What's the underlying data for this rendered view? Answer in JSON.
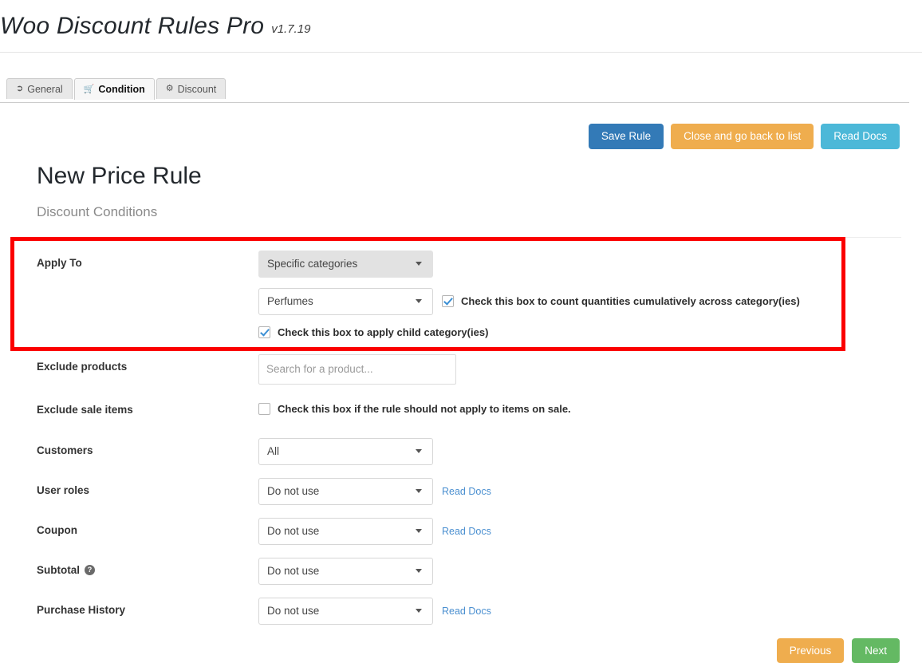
{
  "header": {
    "title": "Woo Discount Rules Pro",
    "version": "v1.7.19"
  },
  "tabs": [
    {
      "label": "General",
      "icon": "tag-icon",
      "glyph": "⚑",
      "active": false
    },
    {
      "label": "Condition",
      "icon": "cart-icon",
      "glyph": "🛒",
      "active": true
    },
    {
      "label": "Discount",
      "icon": "gears-icon",
      "glyph": "⚙",
      "active": false
    }
  ],
  "top_actions": {
    "save_label": "Save Rule",
    "close_label": "Close and go back to list",
    "docs_label": "Read Docs"
  },
  "page": {
    "title": "New Price Rule",
    "subtitle": "Discount Conditions"
  },
  "form": {
    "apply_to": {
      "label": "Apply To",
      "type_value": "Specific categories",
      "category_value": "Perfumes",
      "cumulative_checkbox_label": "Check this box to count quantities cumulatively across category(ies)",
      "cumulative_checked": true,
      "child_checkbox_label": "Check this box to apply child category(ies)",
      "child_checked": true
    },
    "exclude_products": {
      "label": "Exclude products",
      "placeholder": "Search for a product...",
      "value": ""
    },
    "exclude_sale_items": {
      "label": "Exclude sale items",
      "checkbox_label": "Check this box if the rule should not apply to items on sale.",
      "checked": false
    },
    "customers": {
      "label": "Customers",
      "value": "All"
    },
    "user_roles": {
      "label": "User roles",
      "value": "Do not use",
      "link": "Read Docs"
    },
    "coupon": {
      "label": "Coupon",
      "value": "Do not use",
      "link": "Read Docs"
    },
    "subtotal": {
      "label": "Subtotal",
      "help_icon": "help-icon",
      "help_glyph": "?",
      "value": "Do not use"
    },
    "purchase_history": {
      "label": "Purchase History",
      "value": "Do not use",
      "link": "Read Docs"
    }
  },
  "bottom_nav": {
    "previous_label": "Previous",
    "next_label": "Next"
  },
  "colors": {
    "save_blue": "#337ab7",
    "close_orange": "#efad4e",
    "docs_blue": "#4cb8d8",
    "next_green": "#64b963",
    "highlight_red": "#fb0000",
    "link_blue": "#4a8fd0"
  }
}
